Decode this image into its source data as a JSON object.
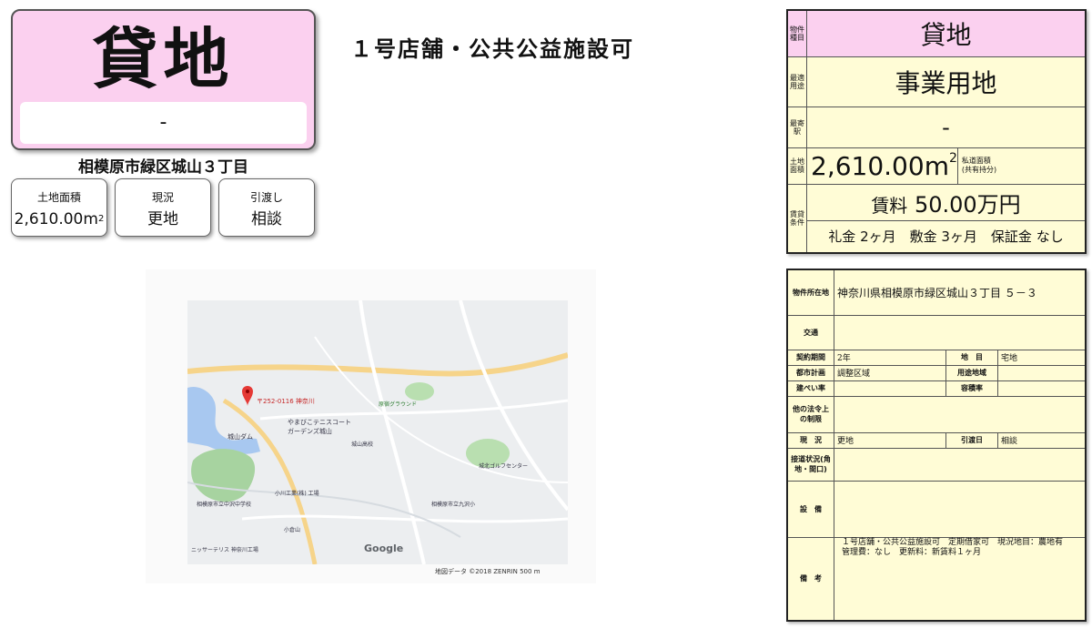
{
  "title": {
    "type": "貸地",
    "price": "-"
  },
  "address": "相模原市緑区城山３丁目",
  "cards": [
    {
      "label": "土地面積",
      "value": "2,610.00m",
      "sup": "2"
    },
    {
      "label": "現況",
      "value": "更地"
    },
    {
      "label": "引渡し",
      "value": "相談"
    }
  ],
  "headline": "１号店舗・公共公益施設可",
  "map": {
    "pin_label": "〒252-0116 神奈川",
    "brand": "Google",
    "footer": "地図データ ©2018 ZENRIN     500 m",
    "places": [
      "城山ダム",
      "やまびこテニスコート",
      "相模原市立中沢中学校",
      "城山高校",
      "小川工業(株) 工場",
      "相模原市立九沢小",
      "城北ゴルフセンター",
      "原宿グラウンド",
      "小倉山",
      "ニッサーテリス 神奈川工場",
      "ガーデンズ城山"
    ]
  },
  "spec": {
    "type_label": "物件種目",
    "type_value": "貸地",
    "use_label": "最適用途",
    "use_value": "事業用地",
    "station_label": "最寄駅",
    "station_value": "-",
    "area_label": "土地面積",
    "area_value": "2,610.00m",
    "area_sup": "2",
    "private_road": "私道面積\n(共有持分)",
    "cond_label": "賃貸条件",
    "rent_label": "賃料",
    "rent_value": "50.00万円",
    "terms": "礼金 2ヶ月　敷金 3ヶ月　保証金 なし"
  },
  "detail": {
    "location_label": "物件所在地",
    "location_value": "神奈川県相模原市緑区城山３丁目 ５－３",
    "transport_label": "交通",
    "rows": [
      {
        "k1": "契約期間",
        "v1": "2年",
        "k2": "地　目",
        "v2": "宅地"
      },
      {
        "k1": "都市計画",
        "v1": "調整区域",
        "k2": "用途地域",
        "v2": ""
      },
      {
        "k1": "建ぺい率",
        "v1": "",
        "k2": "容積率",
        "v2": ""
      }
    ],
    "other_law_label": "他の法令上の制限",
    "status_label": "現　況",
    "status_value": "更地",
    "handover_label": "引渡日",
    "handover_value": "相談",
    "access_label": "接道状況(角地・間口)",
    "facility_label": "設　備",
    "remarks_label": "備　考",
    "remarks_value": "１号店舗・公共公益施設可　定期借家可　現況地目：農地有\n管理費：なし　更新料：新賃料１ヶ月"
  }
}
